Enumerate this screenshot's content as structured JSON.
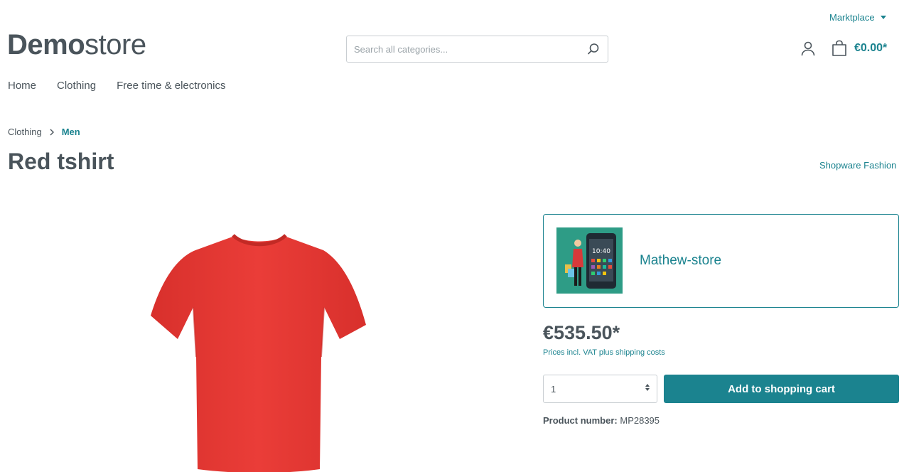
{
  "header": {
    "marketplace_label": "Marktplace",
    "logo_bold": "Demo",
    "logo_light": "store",
    "search_placeholder": "Search all categories...",
    "cart_total": "€0.00*"
  },
  "nav": {
    "items": [
      {
        "label": "Home"
      },
      {
        "label": "Clothing"
      },
      {
        "label": "Free time & electronics"
      }
    ]
  },
  "breadcrumb": {
    "items": [
      "Clothing",
      "Men"
    ]
  },
  "product": {
    "title": "Red tshirt",
    "manufacturer": "Shopware Fashion",
    "price": "€535.50*",
    "tax_note": "Prices incl. VAT plus shipping costs",
    "quantity": "1",
    "add_to_cart_label": "Add to shopping cart",
    "product_number_label": "Product number:",
    "product_number_value": "MP28395",
    "image_color": "#e53a35"
  },
  "seller": {
    "name": "Mathew-store",
    "thumb_phone_text": "10:40"
  },
  "colors": {
    "accent": "#1b838f",
    "text": "#4a545b"
  }
}
